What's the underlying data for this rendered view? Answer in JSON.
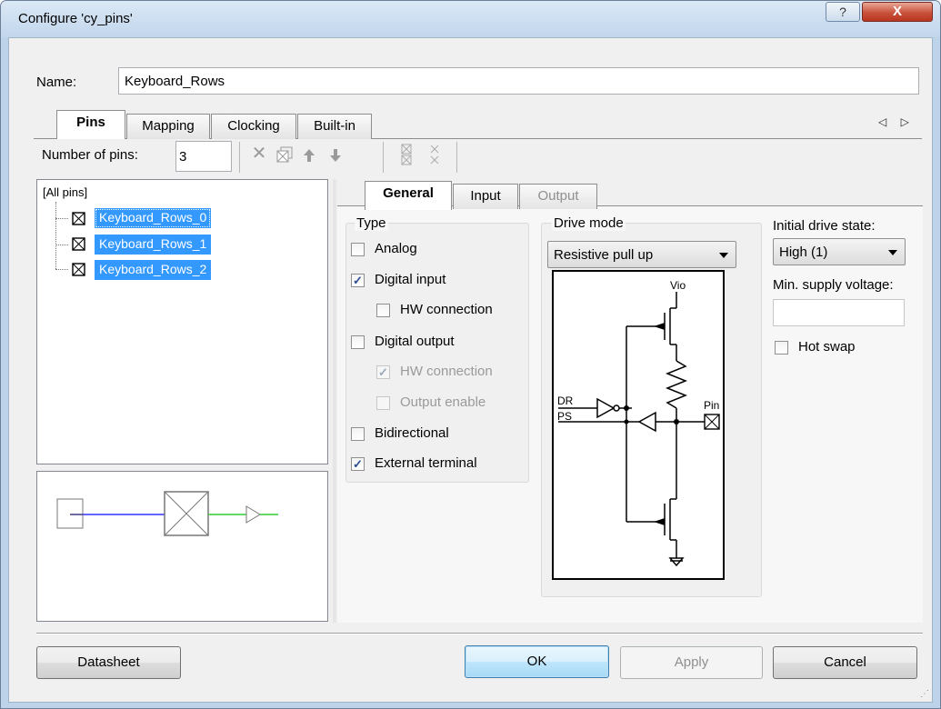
{
  "window": {
    "title": "Configure 'cy_pins'",
    "help_glyph": "?",
    "close_glyph": "X"
  },
  "name_field": {
    "label": "Name:",
    "value": "Keyboard_Rows"
  },
  "outer_tabs": [
    {
      "label": "Pins",
      "active": true
    },
    {
      "label": "Mapping",
      "active": false
    },
    {
      "label": "Clocking",
      "active": false
    },
    {
      "label": "Built-in",
      "active": false
    }
  ],
  "tab_scroll": "◁ ▷",
  "toolbar": {
    "pins_label": "Number of pins:",
    "pins_value": "3"
  },
  "tree": {
    "root": "[All pins]",
    "items": [
      "Keyboard_Rows_0",
      "Keyboard_Rows_1",
      "Keyboard_Rows_2"
    ]
  },
  "inner_tabs": [
    {
      "label": "General",
      "active": true
    },
    {
      "label": "Input",
      "active": false
    },
    {
      "label": "Output",
      "active": false,
      "disabled": true
    }
  ],
  "type_group": {
    "title": "Type",
    "options": [
      {
        "label": "Analog",
        "checked": false,
        "enabled": true
      },
      {
        "label": "Digital input",
        "checked": true,
        "enabled": true
      },
      {
        "label": "HW connection",
        "checked": false,
        "enabled": true
      },
      {
        "label": "Digital output",
        "checked": false,
        "enabled": true
      },
      {
        "label": "HW connection",
        "checked": true,
        "enabled": false
      },
      {
        "label": "Output enable",
        "checked": false,
        "enabled": false
      },
      {
        "label": "Bidirectional",
        "checked": false,
        "enabled": true
      },
      {
        "label": "External terminal",
        "checked": true,
        "enabled": true
      }
    ]
  },
  "drive_mode": {
    "title": "Drive mode",
    "selected": "Resistive pull up",
    "schematic_labels": {
      "vio": "Vio",
      "dr": "DR",
      "ps": "PS",
      "pin": "Pin"
    }
  },
  "initial_drive": {
    "label": "Initial drive state:",
    "selected": "High (1)"
  },
  "min_supply": {
    "label": "Min. supply voltage:",
    "value": ""
  },
  "hot_swap": {
    "label": "Hot swap",
    "checked": false
  },
  "buttons": {
    "datasheet": "Datasheet",
    "ok": "OK",
    "apply": "Apply",
    "cancel": "Cancel"
  },
  "colors": {
    "selection": "#3399ff",
    "preview_wire_in": "#3333ff",
    "preview_wire_out": "#33cc33"
  }
}
